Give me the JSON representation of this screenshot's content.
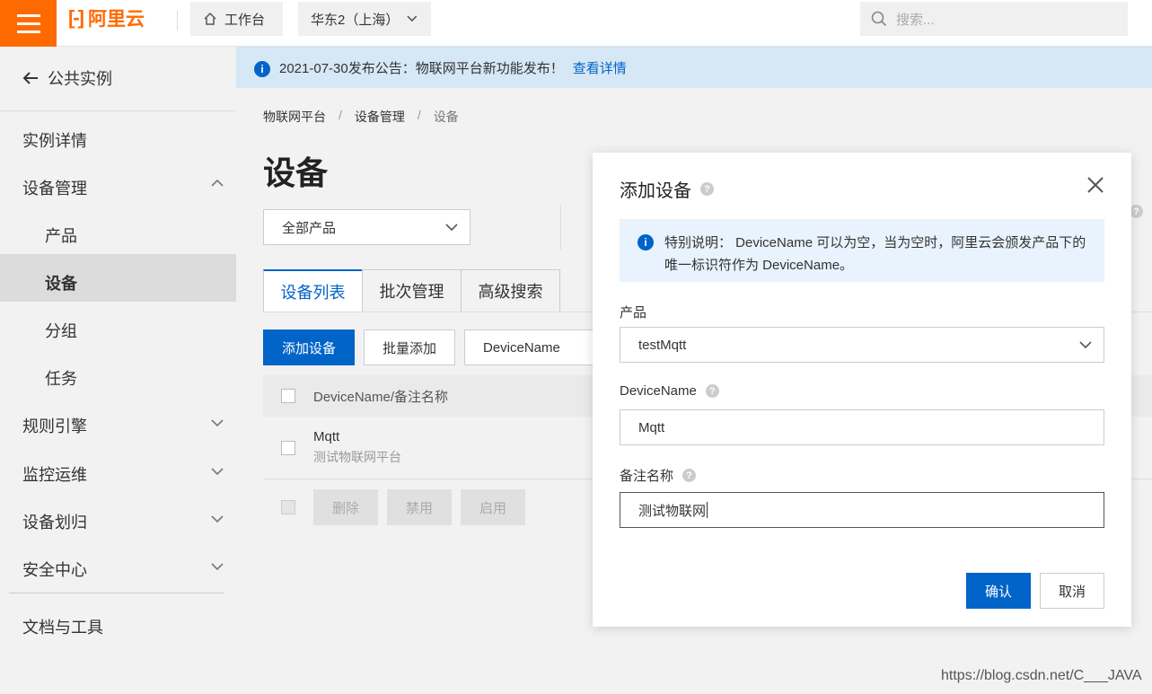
{
  "topbar": {
    "logo_text": "阿里云",
    "home_label": "工作台",
    "region_label": "华东2（上海）",
    "search_placeholder": "搜索..."
  },
  "notice": {
    "text": "2021-07-30发布公告：物联网平台新功能发布！",
    "link": "查看详情"
  },
  "sidebar": {
    "back_label": "公共实例",
    "items": [
      {
        "label": "实例详情"
      },
      {
        "label": "设备管理"
      },
      {
        "label": "产品"
      },
      {
        "label": "设备"
      },
      {
        "label": "分组"
      },
      {
        "label": "任务"
      },
      {
        "label": "规则引擎"
      },
      {
        "label": "监控运维"
      },
      {
        "label": "设备划归"
      },
      {
        "label": "安全中心"
      },
      {
        "label": "文档与工具"
      }
    ]
  },
  "breadcrumb": [
    "物联网平台",
    "设备管理",
    "设备"
  ],
  "page": {
    "title": "设备",
    "product_filter": "全部产品",
    "tabs": [
      "设备列表",
      "批次管理",
      "高级搜索"
    ],
    "add_button": "添加设备",
    "batch_add_button": "批量添加",
    "filter_field": "DeviceName"
  },
  "table": {
    "header": "DeviceName/备注名称",
    "rows": [
      {
        "name": "Mqtt",
        "desc": "测试物联网平台"
      }
    ],
    "batch_actions": [
      "删除",
      "禁用",
      "启用"
    ]
  },
  "dialog": {
    "title": "添加设备",
    "info": "特别说明： DeviceName 可以为空，当为空时，阿里云会颁发产品下的唯一标识符作为 DeviceName。",
    "product_label": "产品",
    "product_value": "testMqtt",
    "devicename_label": "DeviceName",
    "devicename_value": "Mqtt",
    "remark_label": "备注名称",
    "remark_value": "测试物联网",
    "ok_label": "确认",
    "cancel_label": "取消"
  },
  "watermark": "https://blog.csdn.net/C___JAVA",
  "colors": {
    "brand": "#ff6a00",
    "primary": "#0064c8"
  }
}
